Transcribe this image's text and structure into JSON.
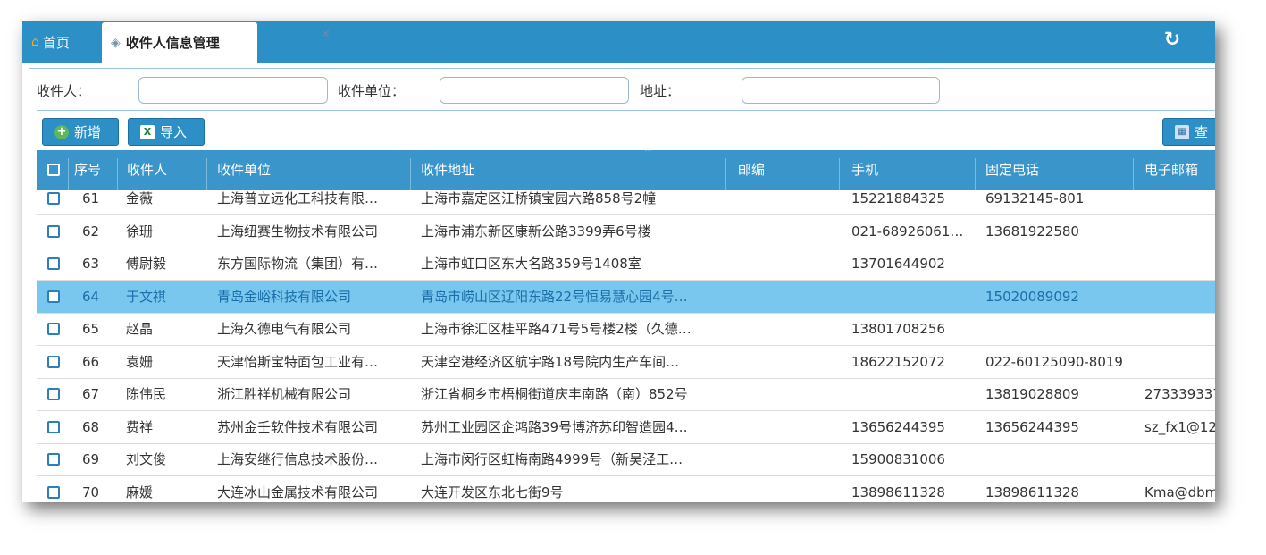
{
  "tabs": {
    "home_label": "首页",
    "active_label": "收件人信息管理",
    "close_glyph": "×"
  },
  "filters": {
    "recipient_label": "收件人：",
    "company_label": "收件单位：",
    "address_label": "地址：",
    "recipient_value": "",
    "company_value": "",
    "address_value": ""
  },
  "toolbar": {
    "add_label": "新增",
    "import_label": "导入",
    "query_label": "查"
  },
  "table": {
    "columns": [
      "序号",
      "收件人",
      "收件单位",
      "收件地址",
      "邮编",
      "手机",
      "固定电话",
      "电子邮箱"
    ],
    "rows": [
      {
        "no": "61",
        "name": "金薇",
        "company": "上海普立远化工科技有限…",
        "address": "上海市嘉定区江桥镇宝园六路858号2幢",
        "zip": "",
        "mobile": "15221884325",
        "phone": "69132145-801",
        "email": ""
      },
      {
        "no": "62",
        "name": "徐珊",
        "company": "上海纽赛生物技术有限公司",
        "address": "上海市浦东新区康新公路3399弄6号楼",
        "zip": "",
        "mobile": "021-68926061…",
        "phone": "13681922580",
        "email": ""
      },
      {
        "no": "63",
        "name": "傅尉毅",
        "company": "东方国际物流（集团）有…",
        "address": "上海市虹口区东大名路359号1408室",
        "zip": "",
        "mobile": "13701644902",
        "phone": "",
        "email": ""
      },
      {
        "no": "64",
        "name": "于文祺",
        "company": "青岛金峪科技有限公司",
        "address": "青岛市崂山区辽阳东路22号恒易慧心园4号…",
        "zip": "",
        "mobile": "",
        "phone": "15020089092",
        "email": ""
      },
      {
        "no": "65",
        "name": "赵晶",
        "company": "上海久德电气有限公司",
        "address": "上海市徐汇区桂平路471号5号楼2楼（久德…",
        "zip": "",
        "mobile": "13801708256",
        "phone": "",
        "email": ""
      },
      {
        "no": "66",
        "name": "袁姗",
        "company": "天津怡斯宝特面包工业有…",
        "address": "天津空港经济区航宇路18号院内生产车间…",
        "zip": "",
        "mobile": "18622152072",
        "phone": "022-60125090-8019",
        "email": ""
      },
      {
        "no": "67",
        "name": "陈伟民",
        "company": "浙江胜祥机械有限公司",
        "address": "浙江省桐乡市梧桐街道庆丰南路（南）852号",
        "zip": "",
        "mobile": "",
        "phone": "13819028809",
        "email": "273339337"
      },
      {
        "no": "68",
        "name": "费祥",
        "company": "苏州金壬软件技术有限公司",
        "address": "苏州工业园区企鸿路39号博济苏印智造园4…",
        "zip": "",
        "mobile": "13656244395",
        "phone": "13656244395",
        "email": "sz_fx1@12"
      },
      {
        "no": "69",
        "name": "刘文俊",
        "company": "上海安继行信息技术股份…",
        "address": "上海市闵行区虹梅南路4999号（新吴泾工…",
        "zip": "",
        "mobile": "15900831006",
        "phone": "",
        "email": ""
      },
      {
        "no": "70",
        "name": "麻媛",
        "company": "大连冰山金属技术有限公司",
        "address": "大连开发区东北七街9号",
        "zip": "",
        "mobile": "13898611328",
        "phone": "13898611328",
        "email": "Kma@dbm"
      }
    ],
    "selected_row_no": "64"
  },
  "colors": {
    "header_bg": "#3a95cb",
    "tabbar_bg": "#2c8fc5",
    "selected_row_bg": "#79c6ee",
    "add_icon": "#5cb85c"
  },
  "icons": {
    "home": "home-icon",
    "tab": "tag-icon",
    "refresh": "refresh-icon",
    "add": "plus-circle-icon",
    "import": "excel-icon",
    "query": "table-icon"
  }
}
